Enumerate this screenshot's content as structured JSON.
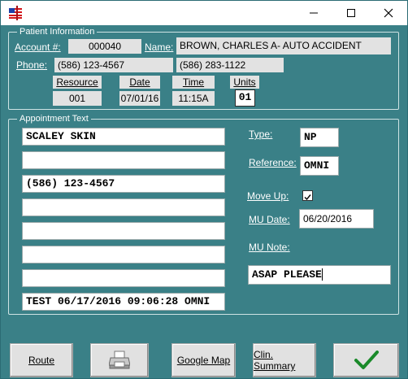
{
  "window": {
    "minimize_glyph": "—",
    "maximize_glyph": "☐",
    "close_glyph": "✕"
  },
  "patient": {
    "legend": "Patient Information",
    "account_label": "Account #:",
    "account_value": "000040",
    "name_label": "Name:",
    "name_value": "BROWN, CHARLES  A- AUTO ACCIDENT",
    "phone_label": "Phone:",
    "phone_value": "(586) 123-4567",
    "phone2_value": "(586) 283-1122",
    "resource_label": "Resource",
    "resource_value": "001",
    "date_label": "Date",
    "date_value": "07/01/16",
    "time_label": "Time",
    "time_value": "11:15A",
    "units_label": "Units",
    "units_value": "01"
  },
  "appointment": {
    "legend": "Appointment Text",
    "lines": [
      "SCALEY SKIN",
      "",
      "(586) 123-4567",
      "",
      "",
      "",
      "",
      "TEST 06/17/2016 09:06:28 OMNI"
    ],
    "type_label": "Type:",
    "type_value": "NP",
    "reference_label": "Reference:",
    "reference_value": "OMNI",
    "moveup_label": "Move Up:",
    "moveup_checked": true,
    "mudate_label": "MU Date:",
    "mudate_value": "06/20/2016",
    "munote_label": "MU Note:",
    "munote_value": "ASAP PLEASE"
  },
  "buttons": {
    "route": "Route",
    "google_map": "Google Map",
    "clin_summary": "Clin. Summary"
  },
  "colors": {
    "background": "#3a8087",
    "checkmark": "#1a8a2a"
  }
}
